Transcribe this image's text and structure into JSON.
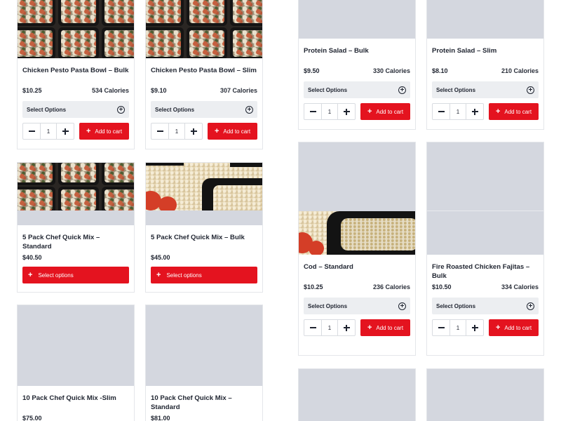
{
  "ui": {
    "select_options_label": "Select Options",
    "select_options_lower": "Select options",
    "add_to_cart": "Add to cart",
    "qty_default": "1"
  },
  "products": [
    {
      "title": "Chicken Pesto Pasta Bowl – Bulk",
      "price": "$10.25",
      "calories": "534 Calories",
      "image": "pesto-pasta-photo"
    },
    {
      "title": "Chicken Pesto Pasta Bowl – Slim",
      "price": "$9.10",
      "calories": "307 Calories",
      "image": "pesto-pasta-photo"
    },
    {
      "title": "Protein Salad – Bulk",
      "price": "$9.50",
      "calories": "330 Calories",
      "image": "placeholder"
    },
    {
      "title": "Protein Salad – Slim",
      "price": "$8.10",
      "calories": "210 Calories",
      "image": "placeholder"
    },
    {
      "title": "5 Pack Chef Quick Mix – Standard",
      "price": "$40.50",
      "calories": "",
      "image": "pesto-pasta-photo"
    },
    {
      "title": "5 Pack Chef Quick Mix – Bulk",
      "price": "$45.00",
      "calories": "",
      "image": "rice-tray-photo"
    },
    {
      "title": "Cod – Standard",
      "price": "$10.25",
      "calories": "236 Calories",
      "image": "cod-rice-photo"
    },
    {
      "title": "Fire Roasted Chicken Fajitas – Bulk",
      "price": "$10.50",
      "calories": "334 Calories",
      "image": "placeholder"
    },
    {
      "title": "10 Pack Chef Quick Mix -Slim",
      "price": "$75.00",
      "calories": "",
      "image": "placeholder"
    },
    {
      "title": "10 Pack Chef Quick Mix – Standard",
      "price": "$81.00",
      "calories": "",
      "image": "placeholder"
    }
  ],
  "colors": {
    "accent": "#e4131f",
    "placeholder": "#d4d7df",
    "select_bg": "#eceef1"
  },
  "icons": [
    "plus-circle-icon",
    "minus-icon",
    "plus-icon"
  ]
}
